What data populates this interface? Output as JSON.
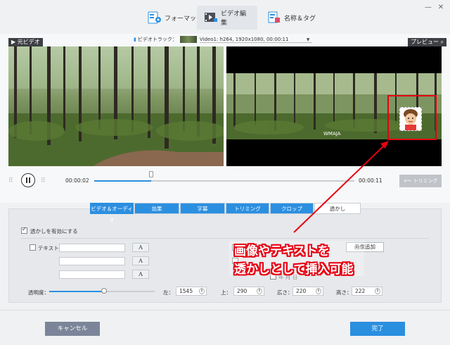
{
  "window": {
    "minimize_glyph": "—",
    "close_glyph": "✕"
  },
  "tabs": [
    {
      "label": "フォーマット",
      "icon": "format-icon"
    },
    {
      "label": "ビデオ編集",
      "icon": "video-edit-icon"
    },
    {
      "label": "名称＆タグ",
      "icon": "tag-icon"
    }
  ],
  "video_track": {
    "label": "ビデオトラック：",
    "value": "Video1: h264, 1920x1080, 00:00:11"
  },
  "panels": {
    "original": "元ビデオ",
    "preview": "プレビュー"
  },
  "watermark_text_overlay": "WMAJA",
  "playback": {
    "current_time": "00:00:02",
    "end_time": "00:00:11",
    "progress": 0.22
  },
  "trim_button": "トリミング",
  "sub_tabs": [
    "ビデオ＆オーディオ",
    "効果",
    "字幕",
    "トリミング",
    "クロップ",
    "透かし"
  ],
  "watermark": {
    "enable_label": "透かしを有効にする",
    "text_label": "テキスト：",
    "text_value": "",
    "font_glyph": "A",
    "image_add_button": "画像追加",
    "date_label": "年 月 日",
    "opacity_label": "透明度：",
    "opacity": 0.52,
    "left_label": "左：",
    "left_value": "1545",
    "top_label": "上：",
    "top_value": "290",
    "width_label": "広さ：",
    "width_value": "220",
    "height_label": "高さ：",
    "height_value": "222"
  },
  "footer": {
    "cancel": "キャンセル",
    "done": "完了"
  },
  "annotation": {
    "line1": "画像やテキストを",
    "line2": "透かしとして挿入可能"
  },
  "colors": {
    "accent": "#2b8fe0",
    "annotation_red": "#e60012",
    "cancel_bg": "#7b8599"
  }
}
